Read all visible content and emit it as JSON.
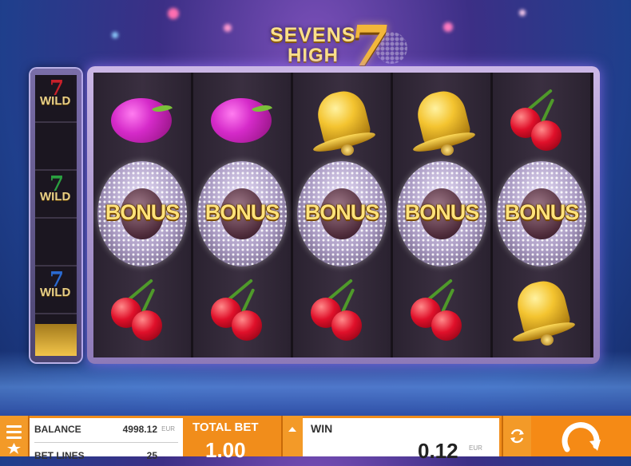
{
  "game": {
    "logo_line1": "SEVENS",
    "logo_line2": "HIGH",
    "logo_seven": "7"
  },
  "wild_reel": {
    "symbols": [
      {
        "seven": "7",
        "label": "WILD",
        "color": "#c8202a"
      },
      {
        "seven": "7",
        "label": "WILD",
        "color": "#2aa040"
      },
      {
        "seven": "7",
        "label": "WILD",
        "color": "#2a6ad0"
      }
    ]
  },
  "reels": [
    [
      "plum",
      "bonus",
      "cherry"
    ],
    [
      "plum",
      "bonus",
      "cherry"
    ],
    [
      "bell",
      "bonus",
      "cherry"
    ],
    [
      "bell",
      "bonus",
      "cherry"
    ],
    [
      "cherry",
      "bonus",
      "bell"
    ]
  ],
  "bonus_label": "BONUS",
  "bottom_bar": {
    "balance_label": "BALANCE",
    "balance_value": "4998.12",
    "balance_currency": "EUR",
    "bet_lines_label": "BET LINES",
    "bet_lines_value": "25",
    "total_bet_label": "TOTAL BET",
    "total_bet_value": "1.00",
    "win_label": "WIN",
    "win_value": "0.12",
    "win_currency": "EUR"
  },
  "colors": {
    "bar_orange": "#f18d1b",
    "bonus_gold": "#ffe27a"
  }
}
